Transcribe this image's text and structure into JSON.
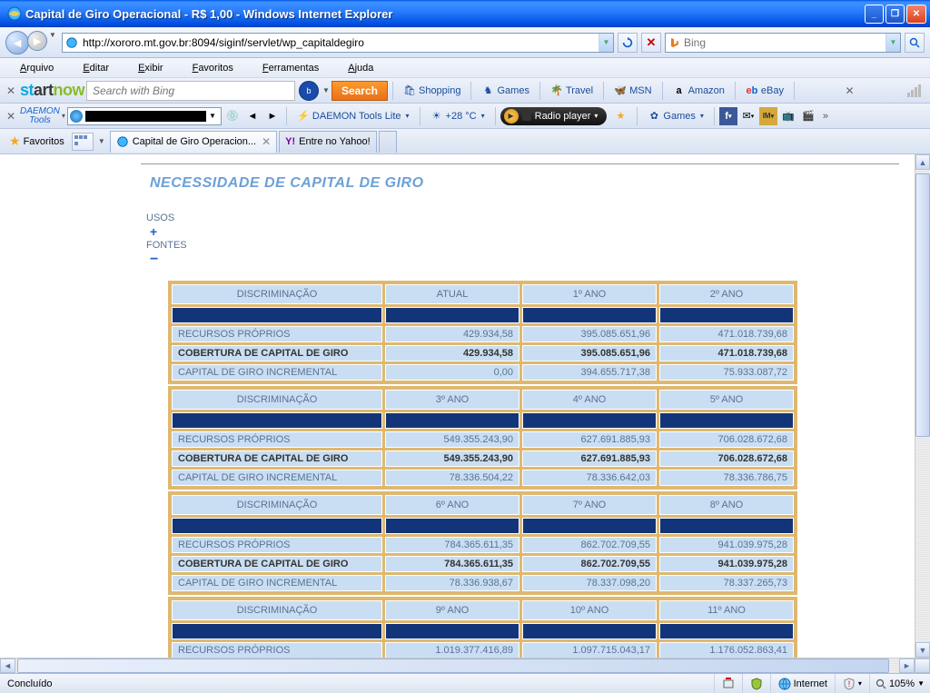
{
  "window": {
    "title": "Capital de Giro Operacional - R$ 1,00 - Windows Internet Explorer"
  },
  "address": {
    "url": "http://xororo.mt.gov.br:8094/siginf/servlet/wp_capitaldegiro"
  },
  "topsearch": {
    "engine": "Bing",
    "placeholder": "Bing"
  },
  "menu": {
    "arquivo": "Arquivo",
    "editar": "Editar",
    "exibir": "Exibir",
    "favoritos": "Favoritos",
    "ferramentas": "Ferramentas",
    "ajuda": "Ajuda"
  },
  "startnow": {
    "search_placeholder": "Search with Bing",
    "search_label": "Search",
    "links": {
      "shopping": "Shopping",
      "games": "Games",
      "travel": "Travel",
      "msn": "MSN",
      "amazon": "Amazon",
      "ebay": "eBay"
    }
  },
  "daemon": {
    "label1": "DAEMON",
    "label2": "Tools",
    "lite": "DAEMON Tools Lite",
    "temp": "+28 °C",
    "radio": "Radio player",
    "games": "Games"
  },
  "favbar": {
    "favoritos": "Favoritos"
  },
  "tabs": {
    "active": "Capital de Giro Operacion...",
    "inactive": "Entre no Yahoo!"
  },
  "page": {
    "title": "NECESSIDADE DE CAPITAL DE GIRO",
    "usos": "USOS",
    "fontes": "FONTES"
  },
  "headers": {
    "disc": "DISCRIMINAÇÃO",
    "atual": "ATUAL",
    "a1": "1º ANO",
    "a2": "2º ANO",
    "a3": "3º ANO",
    "a4": "4º ANO",
    "a5": "5º ANO",
    "a6": "6º ANO",
    "a7": "7º ANO",
    "a8": "8º ANO",
    "a9": "9º ANO",
    "a10": "10º ANO",
    "a11": "11º ANO"
  },
  "rows": {
    "rp": "RECURSOS PRÓPRIOS",
    "cob": "COBERTURA DE CAPITAL DE GIRO",
    "inc": "CAPITAL DE GIRO INCREMENTAL"
  },
  "t1": {
    "rp": {
      "c1": "429.934,58",
      "c2": "395.085.651,96",
      "c3": "471.018.739,68"
    },
    "cob": {
      "c1": "429.934,58",
      "c2": "395.085.651,96",
      "c3": "471.018.739,68"
    },
    "inc": {
      "c1": "0,00",
      "c2": "394.655.717,38",
      "c3": "75.933.087,72"
    }
  },
  "t2": {
    "rp": {
      "c1": "549.355.243,90",
      "c2": "627.691.885,93",
      "c3": "706.028.672,68"
    },
    "cob": {
      "c1": "549.355.243,90",
      "c2": "627.691.885,93",
      "c3": "706.028.672,68"
    },
    "inc": {
      "c1": "78.336.504,22",
      "c2": "78.336.642,03",
      "c3": "78.336.786,75"
    }
  },
  "t3": {
    "rp": {
      "c1": "784.365.611,35",
      "c2": "862.702.709,55",
      "c3": "941.039.975,28"
    },
    "cob": {
      "c1": "784.365.611,35",
      "c2": "862.702.709,55",
      "c3": "941.039.975,28"
    },
    "inc": {
      "c1": "78.336.938,67",
      "c2": "78.337.098,20",
      "c3": "78.337.265,73"
    }
  },
  "t4": {
    "rp": {
      "c1": "1.019.377.416,89",
      "c2": "1.097.715.043,17",
      "c3": "1.176.052.863,41"
    }
  },
  "status": {
    "done": "Concluído",
    "internet": "Internet",
    "zoom": "105%"
  }
}
